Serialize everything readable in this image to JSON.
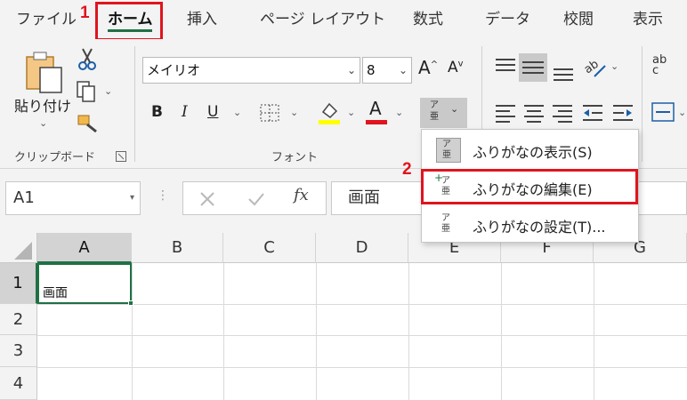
{
  "tabs": [
    {
      "label": "ファイル",
      "active": false
    },
    {
      "label": "ホーム",
      "active": true
    },
    {
      "label": "挿入",
      "active": false
    },
    {
      "label": "ページ レイアウト",
      "active": false
    },
    {
      "label": "数式",
      "active": false
    },
    {
      "label": "データ",
      "active": false
    },
    {
      "label": "校閲",
      "active": false
    },
    {
      "label": "表示",
      "active": false
    }
  ],
  "steps": {
    "one": "1",
    "two": "2"
  },
  "clipboard": {
    "paste_label": "貼り付け",
    "group_label": "クリップボード"
  },
  "font": {
    "name": "メイリオ",
    "size": "8",
    "group_label": "フォント",
    "bold": "B",
    "italic": "I",
    "underline": "U",
    "font_color_glyph": "A",
    "grow": "A",
    "shrink": "A",
    "phonetic_icon": "ア亜"
  },
  "colors": {
    "accent": "#1f7145",
    "highlight": "#e0141e",
    "fill_yellow": "#ffff00",
    "font_red": "#e0141e"
  },
  "formula_bar": {
    "name_box": "A1",
    "fx": "fx",
    "content": "画面"
  },
  "grid": {
    "columns": [
      "A",
      "B",
      "C",
      "D",
      "E",
      "F",
      "G"
    ],
    "rows": [
      "1",
      "2",
      "3",
      "4"
    ],
    "a1_value": "画面"
  },
  "menu": {
    "items": [
      {
        "label": "ふりがなの表示(S)",
        "icon": "furigana-show-icon"
      },
      {
        "label": "ふりがなの編集(E)",
        "icon": "furigana-edit-icon"
      },
      {
        "label": "ふりがなの設定(T)...",
        "icon": "furigana-settings-icon"
      }
    ]
  },
  "alignment": {
    "wrap_icon_label": "ab c"
  }
}
